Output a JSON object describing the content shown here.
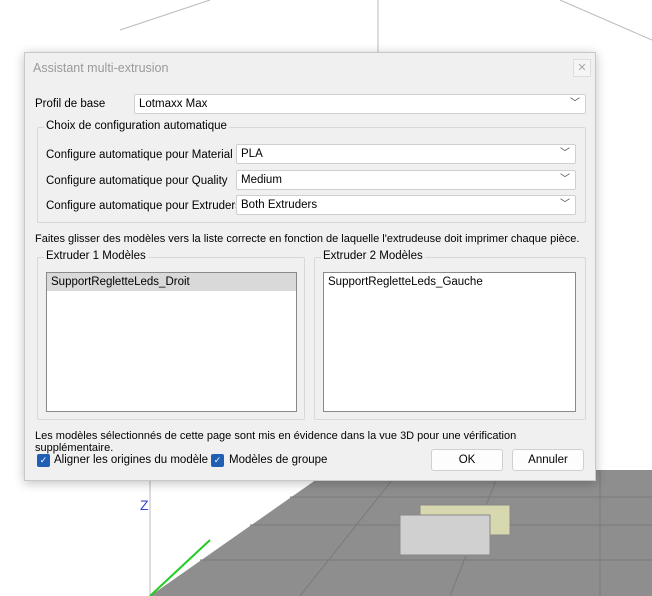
{
  "dialog": {
    "title": "Assistant multi-extrusion",
    "close_icon": "close-icon"
  },
  "base_profile": {
    "label": "Profil de base",
    "value": "Lotmaxx Max"
  },
  "auto_config": {
    "title": "Choix de configuration automatique",
    "rows": [
      {
        "label": "Configure automatique pour Material",
        "value": "PLA"
      },
      {
        "label": "Configure automatique pour Quality",
        "value": "Medium"
      },
      {
        "label": "Configure automatique pour Extruders",
        "value": "Both Extruders"
      }
    ]
  },
  "instruction": "Faites glisser des modèles vers la liste correcte en fonction de laquelle l'extrudeuse doit imprimer chaque pièce.",
  "extruder1": {
    "title": "Extruder 1 Modèles",
    "items": [
      "SupportRegletteLeds_Droit"
    ]
  },
  "extruder2": {
    "title": "Extruder 2 Modèles",
    "items": [
      "SupportRegletteLeds_Gauche"
    ]
  },
  "note": "Les modèles sélectionnés de cette page sont mis en évidence dans la vue 3D pour une vérification supplémentaire.",
  "align_origins": {
    "label": "Aligner les origines du modèle",
    "checked": true
  },
  "group_models": {
    "label": "Modèles de groupe",
    "checked": true
  },
  "ok_label": "OK",
  "cancel_label": "Annuler",
  "axis_label": "Z",
  "colors": {
    "accent": "#1f5fb4",
    "model": "#d8d8b0",
    "grid": "#8c8c8c"
  }
}
